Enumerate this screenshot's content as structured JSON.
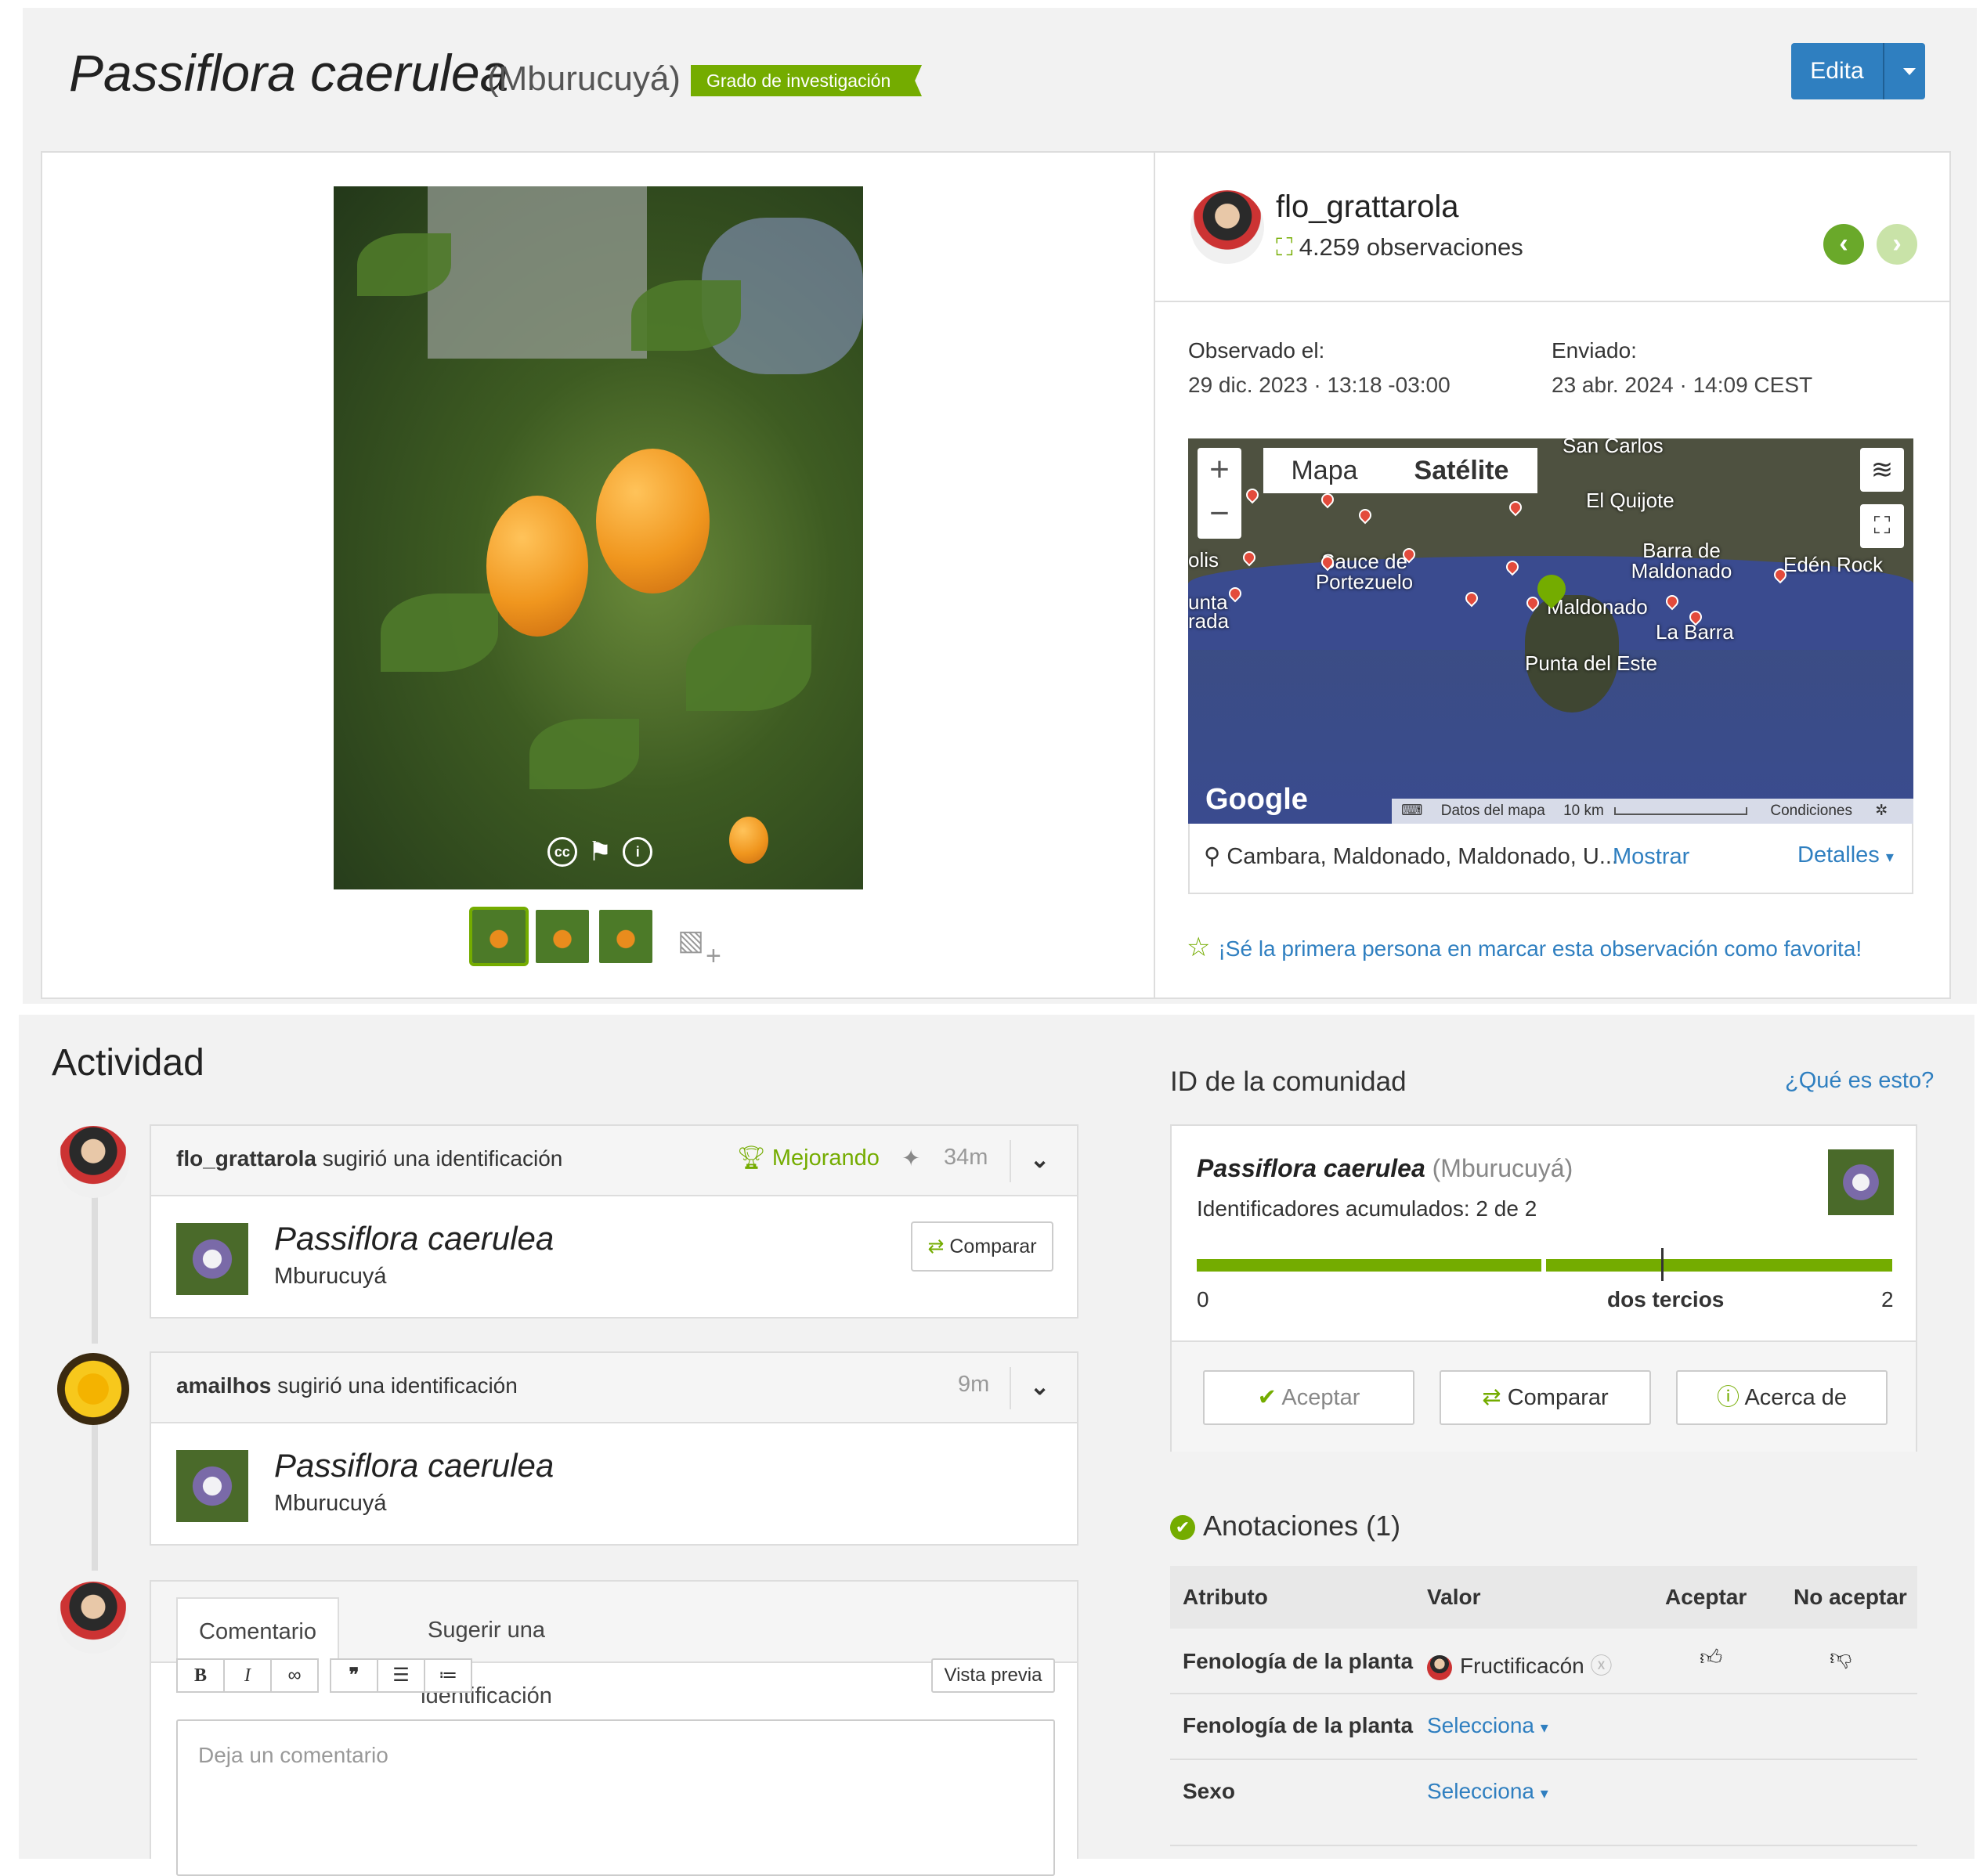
{
  "header": {
    "title": "Passiflora caerulea",
    "common_name": "(Mburucuyá)",
    "grade": "Grado de investigación",
    "edit_label": "Edita"
  },
  "observer": {
    "username": "flo_grattarola",
    "observations": "4.259 observaciones"
  },
  "dates": {
    "observed_label": "Observado el:",
    "observed_value": "29 dic. 2023 · 13:18 -03:00",
    "submitted_label": "Enviado:",
    "submitted_value": "23 abr. 2024 · 14:09 CEST"
  },
  "map": {
    "tab_map": "Mapa",
    "tab_satellite": "Satélite",
    "places": [
      "San Carlos",
      "El Quijote",
      "Barra de Maldonado",
      "Edén Rock",
      "Sauce de Portezuelo",
      "Maldonado",
      "La Barra",
      "Punta del Este",
      "olis",
      "unta",
      "rada"
    ],
    "brand": "Google",
    "footer_data": "Datos del mapa",
    "footer_scale": "10 km",
    "footer_terms": "Condiciones",
    "location": "Cambara, Maldonado, Maldonado, U...",
    "show": "Mostrar",
    "details": "Detalles"
  },
  "favorite_text": "¡Sé la primera persona en marcar esta observación como favorita!",
  "activity": {
    "title": "Actividad",
    "items": [
      {
        "user": "flo_grattarola",
        "action": " sugirió una identificación",
        "badge": "Mejorando",
        "time": "34m",
        "taxon": "Passiflora caerulea",
        "common": "Mburucuyá",
        "compare": "Comparar"
      },
      {
        "user": "amailhos",
        "action": " sugirió una identificación",
        "time": "9m",
        "taxon": "Passiflora caerulea",
        "common": "Mburucuyá"
      }
    ],
    "composer": {
      "tab_comment": "Comentario",
      "tab_suggest": "Sugerir una identificación",
      "toolbar": [
        "B",
        "I",
        "∞",
        "❞",
        "☰",
        "≔"
      ],
      "preview": "Vista previa",
      "placeholder": "Deja un comentario"
    }
  },
  "community": {
    "title": "ID de la comunidad",
    "help": "¿Qué es esto?",
    "taxon": "Passiflora caerulea",
    "common": "(Mburucuyá)",
    "cumulative": "Identificadores acumulados: 2 de 2",
    "scale_min": "0",
    "scale_mid": "dos tercios",
    "scale_max": "2",
    "btn_accept": "Aceptar",
    "btn_compare": "Comparar",
    "btn_about": "Acerca de"
  },
  "annotations": {
    "title": "Anotaciones (1)",
    "headers": [
      "Atributo",
      "Valor",
      "Aceptar",
      "No aceptar"
    ],
    "rows": [
      {
        "attribute": "Fenología de la planta",
        "value": "Fructificacón"
      },
      {
        "attribute": "Fenología de la planta",
        "value": "Selecciona"
      },
      {
        "attribute": "Sexo",
        "value": "Selecciona"
      }
    ]
  },
  "colors": {
    "brand_green": "#74ac00",
    "link_blue": "#2f7fc0",
    "edit_button": "#2f7fc0"
  }
}
